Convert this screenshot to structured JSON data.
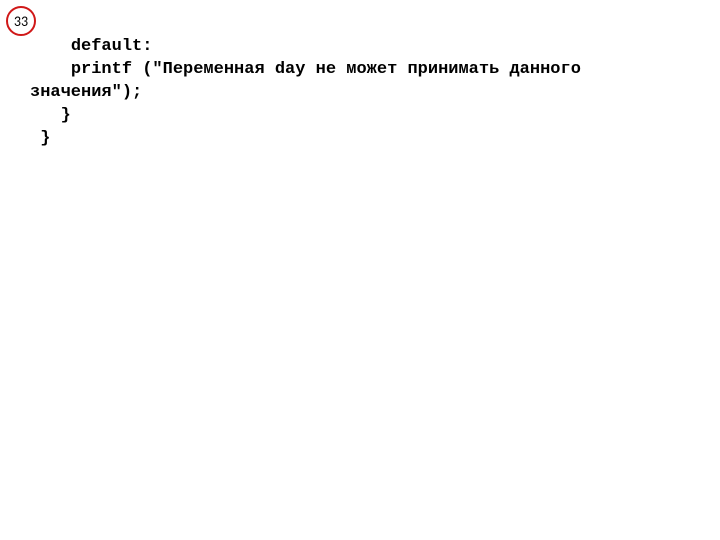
{
  "page_number": "33",
  "badge_border_color": "#d01818",
  "code": {
    "lines": [
      "    default:",
      "    printf (\"Переменная day не может принимать данного значения\");",
      "   }",
      " }"
    ]
  }
}
